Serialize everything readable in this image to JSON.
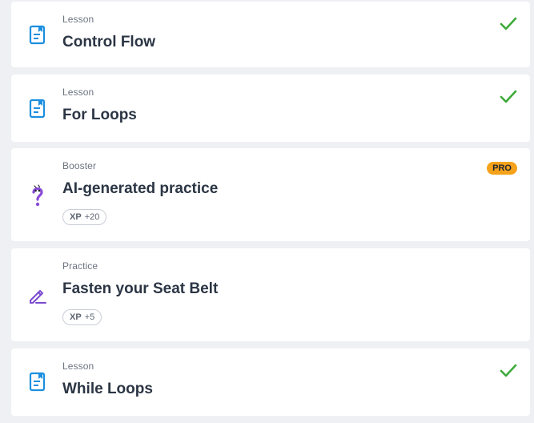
{
  "items": [
    {
      "type": "Lesson",
      "title": "Control Flow",
      "status": "completed",
      "icon": "lesson-icon"
    },
    {
      "type": "Lesson",
      "title": "For Loops",
      "status": "completed",
      "icon": "lesson-icon"
    },
    {
      "type": "Booster",
      "title": "AI-generated practice",
      "badge": "PRO",
      "xp_label": "XP",
      "xp_value": "+20",
      "icon": "question-mark-icon"
    },
    {
      "type": "Practice",
      "title": "Fasten your Seat Belt",
      "xp_label": "XP",
      "xp_value": "+5",
      "icon": "pencil-icon"
    },
    {
      "type": "Lesson",
      "title": "While Loops",
      "status": "completed",
      "icon": "lesson-icon"
    }
  ],
  "colors": {
    "background": "#eef0f3",
    "card": "#ffffff",
    "check": "#3daa3a",
    "lesson_icon": "#1c8fe0",
    "booster_icon": "#8a4bd8",
    "practice_icon": "#7a4ad0",
    "pro_badge": "#f5a21b"
  }
}
